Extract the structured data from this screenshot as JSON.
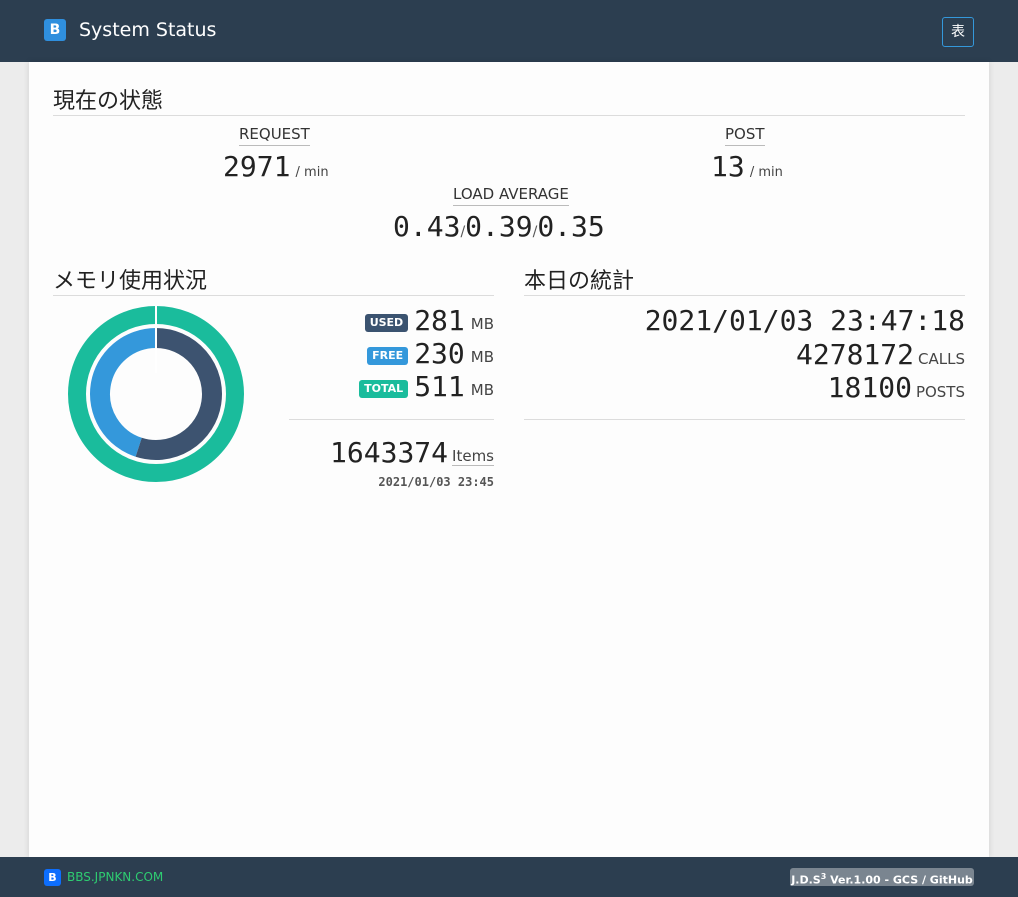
{
  "header": {
    "brand_icon": "B",
    "title": "System Status",
    "table_button": "表"
  },
  "current": {
    "title": "現在の状態",
    "request_label": "REQUEST",
    "request_value": "2971",
    "request_unit": "/ min",
    "post_label": "POST",
    "post_value": "13",
    "post_unit": "/ min",
    "load_label": "LOAD AVERAGE",
    "load": [
      "0.43",
      "0.39",
      "0.35"
    ],
    "load_sep": "/"
  },
  "memory": {
    "title": "メモリ使用状況",
    "rows": [
      {
        "badge": "USED",
        "value": "281",
        "unit": "MB",
        "color": "#3b5370"
      },
      {
        "badge": "FREE",
        "value": "230",
        "unit": "MB",
        "color": "#3498db"
      },
      {
        "badge": "TOTAL",
        "value": "511",
        "unit": "MB",
        "color": "#1abc9c"
      }
    ],
    "used_fraction": 0.55,
    "items_value": "1643374",
    "items_label": "Items",
    "timestamp": "2021/01/03 23:45",
    "colors": {
      "used": "#3d5370",
      "free": "#3498db",
      "total": "#1abc9c"
    }
  },
  "today": {
    "title": "本日の統計",
    "datetime": "2021/01/03 23:47:18",
    "calls_value": "4278172",
    "calls_label": "CALLS",
    "posts_value": "18100",
    "posts_label": "POSTS"
  },
  "footer": {
    "icon": "B",
    "link": "BBS.JPNKN.COM",
    "version_prefix": "J.D.S",
    "version_sup": "3",
    "version_suffix": " Ver.1.00 - GCS / GitHub"
  }
}
